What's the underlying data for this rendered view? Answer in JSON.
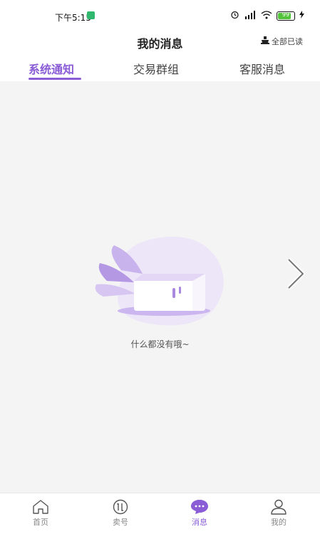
{
  "status": {
    "time": "下午5:15",
    "battery": "99"
  },
  "header": {
    "title": "我的消息",
    "mark_all_read": "全部已读"
  },
  "tabs": [
    {
      "label": "系统通知",
      "active": true
    },
    {
      "label": "交易群组",
      "active": false
    },
    {
      "label": "客服消息",
      "active": false
    }
  ],
  "empty_state": {
    "message": "什么都没有哦~"
  },
  "bottom_nav": [
    {
      "label": "首页",
      "icon": "home-icon",
      "active": false
    },
    {
      "label": "卖号",
      "icon": "sell-icon",
      "active": false
    },
    {
      "label": "消息",
      "icon": "message-icon",
      "active": true
    },
    {
      "label": "我的",
      "icon": "profile-icon",
      "active": false
    }
  ],
  "colors": {
    "accent": "#8a5cd6",
    "background": "#f4f4f4"
  }
}
